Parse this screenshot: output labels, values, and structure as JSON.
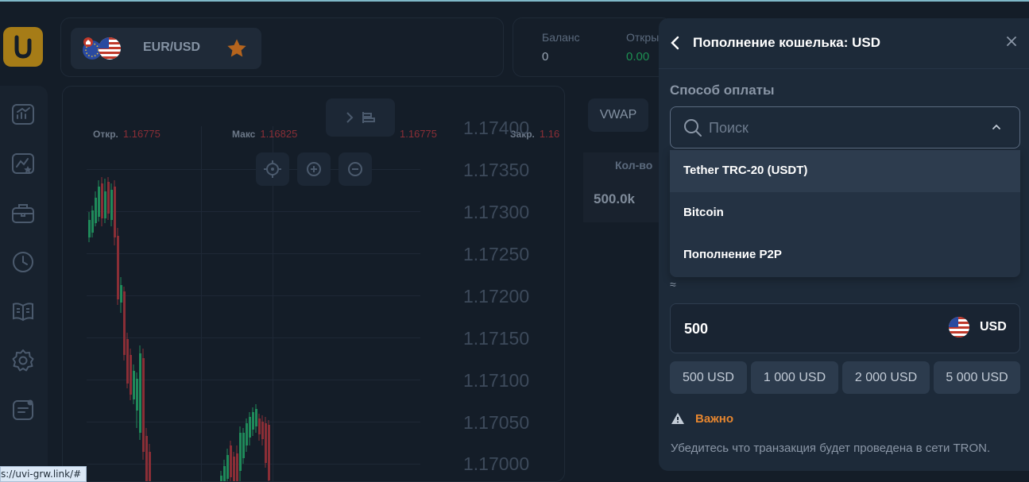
{
  "header": {
    "asset": "EUR/USD",
    "balance_label": "Баланс",
    "balance_value": "0",
    "open_label": "Откры",
    "open_value": "0.00"
  },
  "chart": {
    "ohlc": [
      {
        "label": "Откр.",
        "value": "1.16775"
      },
      {
        "label": "Макс",
        "value": "1.16825"
      },
      {
        "label": "",
        "value": "1.16775"
      },
      {
        "label": "Закр.",
        "value": "1.16"
      }
    ],
    "price_ticks": [
      "1.17400",
      "1.17350",
      "1.17300",
      "1.17250",
      "1.17200",
      "1.17150",
      "1.17100",
      "1.17050",
      "1.17000"
    ]
  },
  "side": {
    "vwap_label": "VWAP",
    "qty_header": "Кол-во",
    "qty_value": "500.0k"
  },
  "modal": {
    "title": "Пополнение кошелька: USD",
    "payment_label": "Способ оплаты",
    "search_placeholder": "Поиск",
    "options": [
      "Tether TRC-20 (USDT)",
      "Bitcoin",
      "Пополнение P2P"
    ],
    "approx": "≈",
    "amount": "500",
    "currency": "USD",
    "quick_amounts": [
      "500 USD",
      "1 000 USD",
      "2 000 USD",
      "5 000 USD"
    ],
    "important_label": "Важно",
    "note": "Убедитесь что транзакция будет проведена в сети TRON."
  },
  "status_url": "s://uvi-grw.link/#",
  "colors": {
    "accent_orange": "#e6862f",
    "bull": "#1f8a5a",
    "bear": "#8a2e36",
    "logo": "#a67c17"
  }
}
